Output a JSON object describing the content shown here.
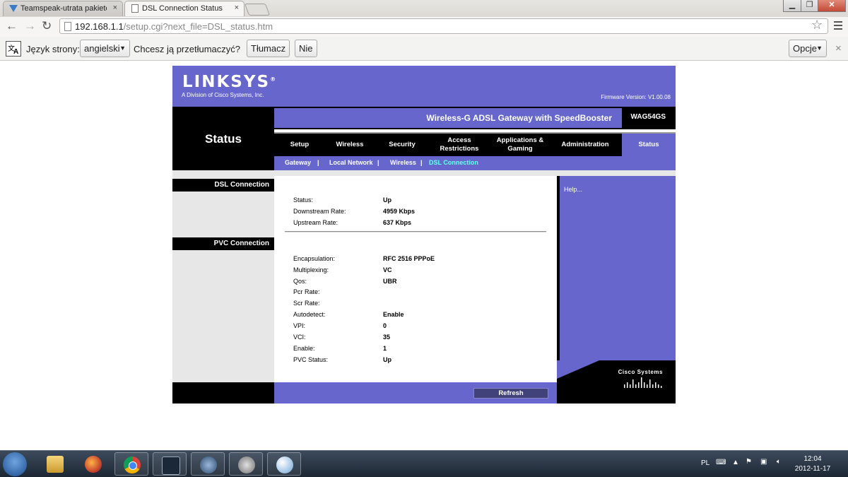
{
  "tabs": [
    {
      "title": "Teamspeak-utrata pakietó",
      "close": "×"
    },
    {
      "title": "DSL Connection Status",
      "close": "×"
    }
  ],
  "address": {
    "host": "192.168.1.1",
    "path": "/setup.cgi?next_file=DSL_status.htm"
  },
  "translate_bar": {
    "page_lang_label": "Język strony:",
    "language": "angielski",
    "question": "Chcesz ją przetłumaczyć?",
    "translate_btn": "Tłumacz",
    "no_btn": "Nie",
    "options_btn": "Opcje",
    "close": "×"
  },
  "router": {
    "logo": "LINKSYS",
    "logo_reg": "®",
    "logo_sub": "A Division of Cisco Systems, Inc.",
    "firmware": "Firmware Version: V1.00.08",
    "section": "Status",
    "product": "Wireless-G ADSL Gateway with SpeedBooster",
    "model": "WAG54GS",
    "nav": [
      "Setup",
      "Wireless",
      "Security",
      "Access Restrictions",
      "Applications & Gaming",
      "Administration",
      "Status"
    ],
    "subnav": [
      "Gateway",
      "Local Network",
      "Wireless",
      "DSL Connection"
    ],
    "subnav_sep": "|",
    "left_headings": [
      "DSL Connection",
      "PVC Connection"
    ],
    "dsl": [
      {
        "label": "Status:",
        "value": "Up"
      },
      {
        "label": "Downstream Rate:",
        "value": "4959 Kbps"
      },
      {
        "label": "Upstream Rate:",
        "value": "637 Kbps"
      }
    ],
    "pvc": [
      {
        "label": "Encapsulation:",
        "value": "RFC 2516 PPPoE"
      },
      {
        "label": "Multiplexing:",
        "value": "VC"
      },
      {
        "label": "Qos:",
        "value": "UBR"
      },
      {
        "label": "Pcr Rate:",
        "value": ""
      },
      {
        "label": "Scr Rate:",
        "value": ""
      },
      {
        "label": "Autodetect:",
        "value": "Enable"
      },
      {
        "label": "VPI:",
        "value": "0"
      },
      {
        "label": "VCI:",
        "value": "35"
      },
      {
        "label": "Enable:",
        "value": "1"
      },
      {
        "label": "PVC Status:",
        "value": "Up"
      }
    ],
    "help": "Help...",
    "refresh": "Refresh",
    "cisco": "Cisco Systems",
    "accent": "#6666cc"
  },
  "taskbar": {
    "lang": "PL",
    "time": "12:04",
    "date": "2012-11-17"
  }
}
